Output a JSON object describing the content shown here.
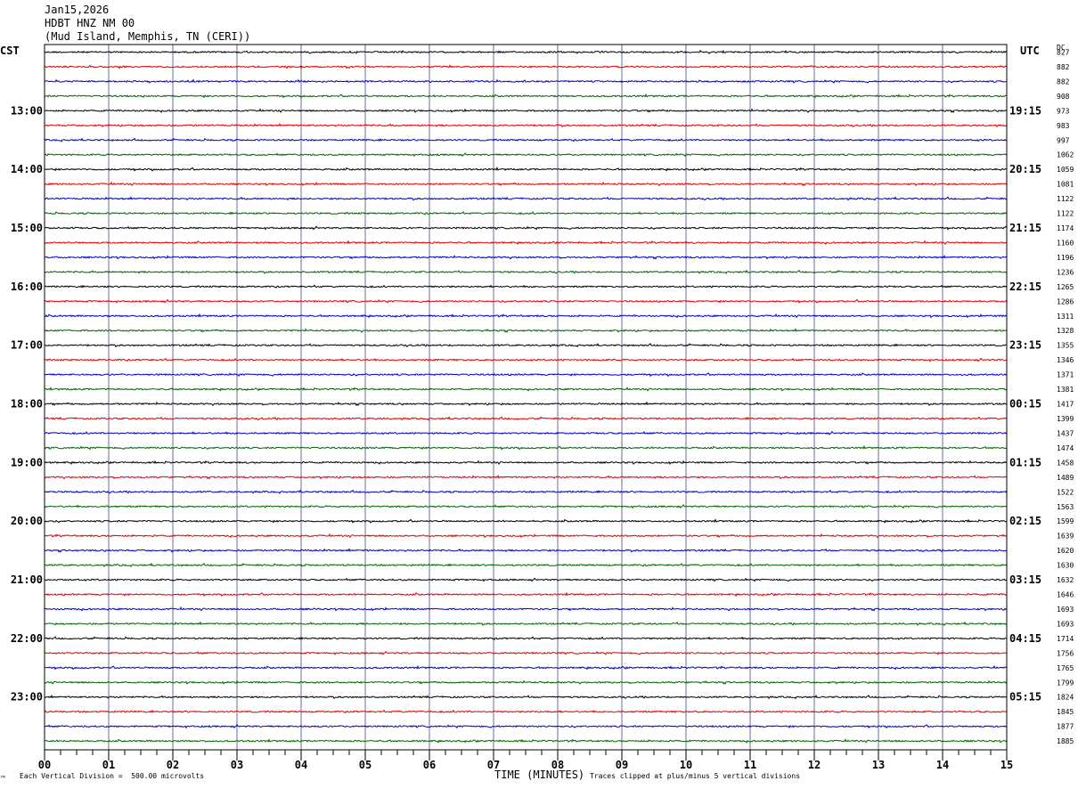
{
  "header": {
    "date": "Jan15,2026",
    "station": "HDBT HNZ NM 00",
    "location": "(Mud Island, Memphis, TN (CERI))",
    "left_tz": "CST",
    "right_tz": "UTC",
    "dc_label": "DC"
  },
  "footer": {
    "scale_note": "Each Vertical Division =  500.00 microvolts",
    "x_axis_label": "TIME (MINUTES)",
    "clip_note": "Traces clipped at plus/minus 5 vertical divisions",
    "corner_mark": "™"
  },
  "colors": {
    "trace_cycle": [
      "#000000",
      "#e00000",
      "#0000c0",
      "#006400"
    ],
    "gridline": "#6b6b9b",
    "frame": "#000000"
  },
  "chart_data": {
    "type": "line",
    "x_range_minutes": [
      0,
      15
    ],
    "x_ticks": [
      "00",
      "01",
      "02",
      "03",
      "04",
      "05",
      "06",
      "07",
      "08",
      "09",
      "10",
      "11",
      "12",
      "13",
      "14",
      "15"
    ],
    "left_hour_labels": [
      "13:00",
      "14:00",
      "15:00",
      "16:00",
      "17:00",
      "18:00",
      "19:00",
      "20:00",
      "21:00",
      "22:00",
      "23:00"
    ],
    "right_hour_labels": [
      "19:15",
      "20:15",
      "21:15",
      "22:15",
      "23:15",
      "00:15",
      "01:15",
      "02:15",
      "03:15",
      "04:15",
      "05:15"
    ],
    "dc_offsets": [
      827,
      882,
      882,
      908,
      973,
      983,
      997,
      1062,
      1059,
      1081,
      1122,
      1122,
      1174,
      1160,
      1196,
      1236,
      1265,
      1286,
      1311,
      1328,
      1355,
      1346,
      1371,
      1381,
      1417,
      1399,
      1437,
      1474,
      1458,
      1489,
      1522,
      1563,
      1599,
      1639,
      1620,
      1630,
      1632,
      1646,
      1693,
      1693,
      1714,
      1756,
      1765,
      1799,
      1824,
      1845,
      1877,
      1885
    ],
    "grid": true,
    "legend": "none"
  }
}
